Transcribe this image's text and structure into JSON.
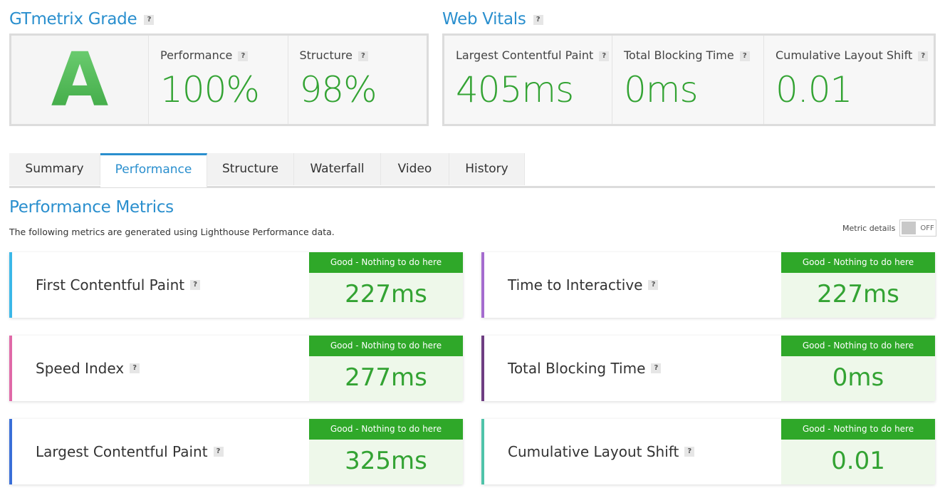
{
  "grade_section": {
    "title": "GTmetrix Grade",
    "grade": "A",
    "performance_label": "Performance",
    "performance_value": "100%",
    "structure_label": "Structure",
    "structure_value": "98%"
  },
  "vitals_section": {
    "title": "Web Vitals",
    "lcp_label": "Largest Contentful Paint",
    "lcp_value": "405ms",
    "tbt_label": "Total Blocking Time",
    "tbt_value": "0ms",
    "cls_label": "Cumulative Layout Shift",
    "cls_value": "0.01"
  },
  "help_glyph": "?",
  "tabs": [
    {
      "label": "Summary"
    },
    {
      "label": "Performance"
    },
    {
      "label": "Structure"
    },
    {
      "label": "Waterfall"
    },
    {
      "label": "Video"
    },
    {
      "label": "History"
    }
  ],
  "active_tab": "Performance",
  "metrics_section": {
    "title": "Performance Metrics",
    "subtitle": "The following metrics are generated using Lighthouse Performance data.",
    "details_label": "Metric details",
    "details_state": "OFF"
  },
  "metrics": [
    {
      "name": "First Contentful Paint",
      "status": "Good - Nothing to do here",
      "value": "227ms",
      "color": "#3bb8e8"
    },
    {
      "name": "Time to Interactive",
      "status": "Good - Nothing to do here",
      "value": "227ms",
      "color": "#a56ccf"
    },
    {
      "name": "Speed Index",
      "status": "Good - Nothing to do here",
      "value": "277ms",
      "color": "#e06aa8"
    },
    {
      "name": "Total Blocking Time",
      "status": "Good - Nothing to do here",
      "value": "0ms",
      "color": "#6e3e82"
    },
    {
      "name": "Largest Contentful Paint",
      "status": "Good - Nothing to do here",
      "value": "325ms",
      "color": "#3a6fd8"
    },
    {
      "name": "Cumulative Layout Shift",
      "status": "Good - Nothing to do here",
      "value": "0.01",
      "color": "#4fc3a9"
    }
  ],
  "colors": {
    "accent": "#2a8fce",
    "good_green": "#2fa829",
    "value_green": "#33a333"
  }
}
